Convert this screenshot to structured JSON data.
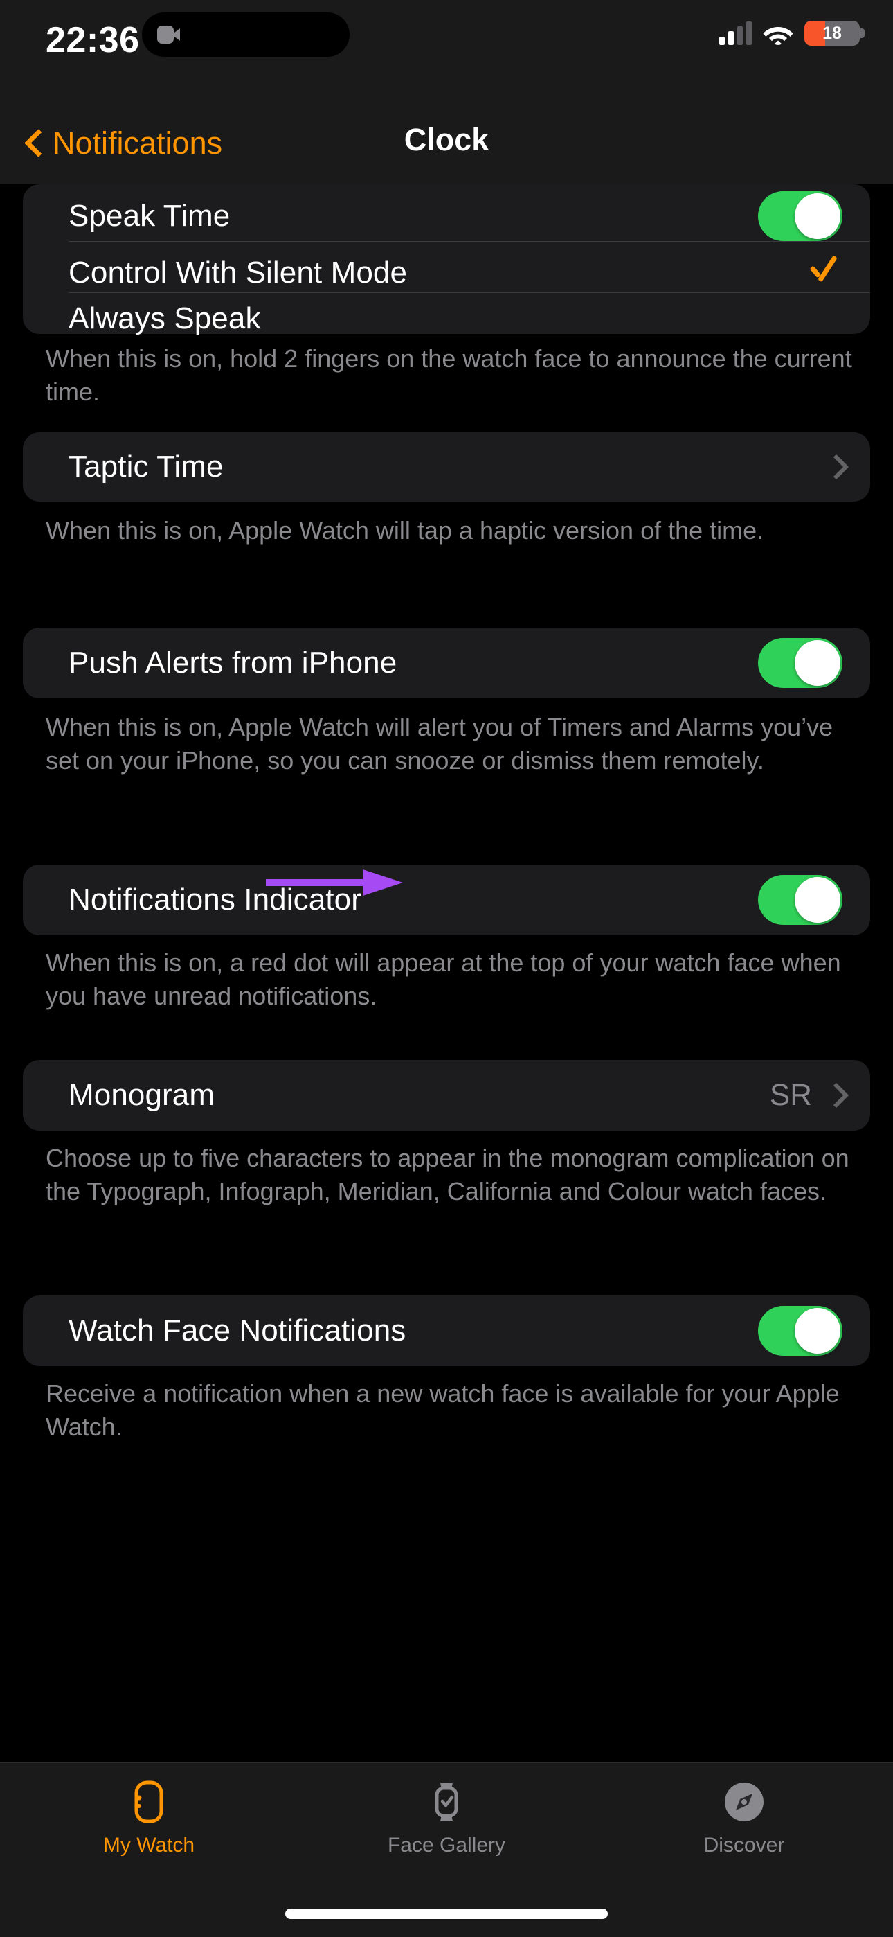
{
  "status_bar": {
    "time": "22:36",
    "battery_percent": "18",
    "cellular_icon": "cellular-bars-icon",
    "wifi_icon": "wifi-icon",
    "camera_icon": "video-camera-icon",
    "battery_icon": "battery-low-icon"
  },
  "nav": {
    "back_label": "Notifications",
    "back_icon": "chevron-left-icon",
    "title": "Clock"
  },
  "colors": {
    "accent": "#FF9500",
    "toggle_on": "#30D158",
    "card": "#1C1C1E",
    "page": "#000000",
    "secondary_text": "#8A8A8E",
    "battery_low": "#F8562A",
    "annotation_arrow": "#A64BF4"
  },
  "sections": [
    {
      "rows": [
        {
          "label": "Speak Time",
          "control": "toggle",
          "value": "on"
        },
        {
          "label": "Control With Silent Mode",
          "control": "checkmark",
          "value": "selected"
        },
        {
          "label": "Always Speak",
          "control": "none",
          "value": ""
        }
      ],
      "footer": "When this is on, hold 2 fingers on the watch face to announce the current time."
    },
    {
      "rows": [
        {
          "label": "Taptic Time",
          "control": "disclosure",
          "value": ""
        }
      ],
      "footer": "When this is on, Apple Watch will tap a haptic version of the time."
    },
    {
      "rows": [
        {
          "label": "Push Alerts from iPhone",
          "control": "toggle",
          "value": "on"
        }
      ],
      "footer": "When this is on, Apple Watch will alert you of Timers and Alarms you’ve set on your iPhone, so you can snooze or dismiss them remotely."
    },
    {
      "rows": [
        {
          "label": "Notifications Indicator",
          "control": "toggle",
          "value": "on"
        }
      ],
      "footer": "When this is on, a red dot will appear at the top of your watch face when you have unread notifications."
    },
    {
      "rows": [
        {
          "label": "Monogram",
          "control": "disclosure",
          "value": "SR"
        }
      ],
      "footer": "Choose up to five characters to appear in the monogram complication on the Typograph, Infograph, Meridian, California and Colour watch faces."
    },
    {
      "rows": [
        {
          "label": "Watch Face Notifications",
          "control": "toggle",
          "value": "on"
        }
      ],
      "footer": "Receive a notification when a new watch face is available for your Apple Watch."
    }
  ],
  "annotation": {
    "type": "arrow",
    "points_to": "Push Alerts from iPhone toggle",
    "color": "#A64BF4"
  },
  "tabbar": {
    "items": [
      {
        "label": "My Watch",
        "icon": "apple-watch-icon",
        "active": true
      },
      {
        "label": "Face Gallery",
        "icon": "watch-face-icon",
        "active": false
      },
      {
        "label": "Discover",
        "icon": "compass-icon",
        "active": false
      }
    ]
  }
}
